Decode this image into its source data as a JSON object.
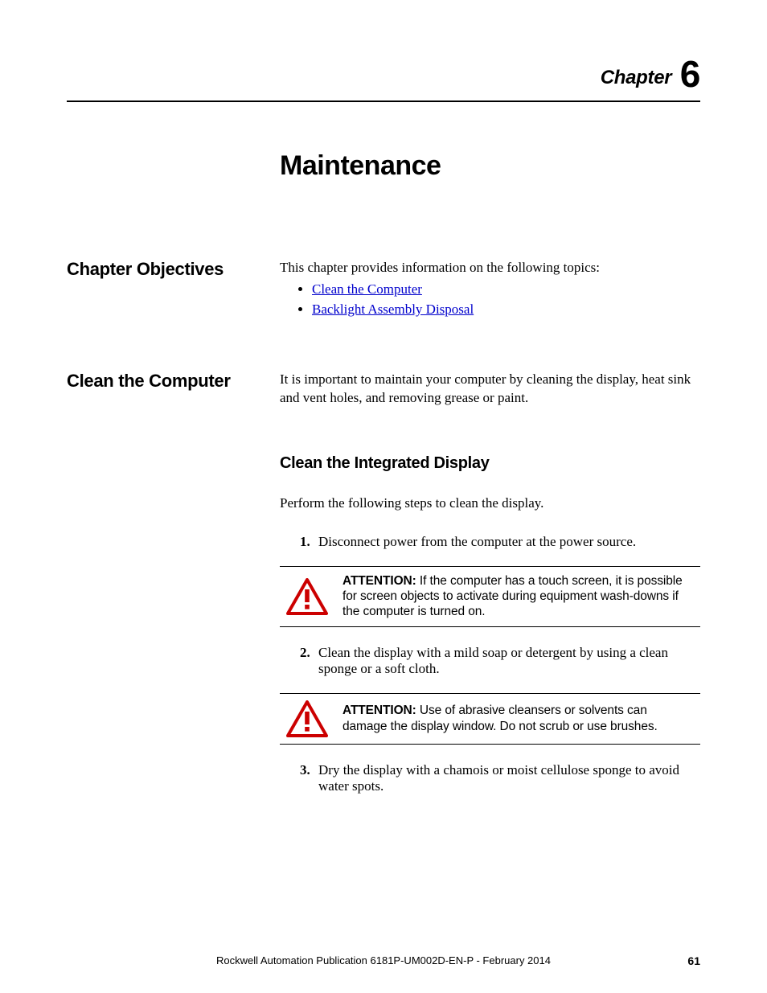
{
  "chapter": {
    "label": "Chapter",
    "number": "6"
  },
  "title": "Maintenance",
  "objectives": {
    "heading": "Chapter Objectives",
    "intro": "This chapter provides information on the following topics:",
    "links": [
      "Clean the Computer",
      "Backlight Assembly Disposal"
    ]
  },
  "clean": {
    "heading": "Clean the Computer",
    "intro": "It is important to maintain your computer by cleaning the display, heat sink and vent holes, and removing grease or paint.",
    "subhead": "Clean the Integrated Display",
    "lead": "Perform the following steps to clean the display.",
    "steps": [
      "Disconnect power from the computer at the power source.",
      "Clean the display with a mild soap or detergent by using a clean sponge or a soft cloth.",
      "Dry the display with a chamois or moist cellulose sponge to avoid water spots."
    ],
    "attn_label": "ATTENTION:",
    "attn1": "If the computer has a touch screen, it is possible for screen objects to activate during equipment wash-downs if the computer is turned on.",
    "attn2": "Use of abrasive cleansers or solvents can damage the display window. Do not scrub or use brushes."
  },
  "footer": {
    "text": "Rockwell Automation Publication 6181P-UM002D-EN-P - February 2014",
    "page": "61"
  }
}
